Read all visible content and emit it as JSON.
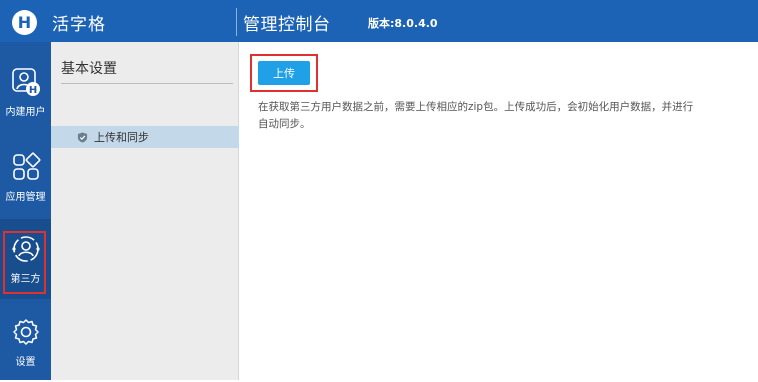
{
  "header": {
    "logo_letter": "H",
    "app_name": "活字格",
    "console_title": "管理控制台",
    "version": "版本:8.0.4.0"
  },
  "leftnav": {
    "items": [
      {
        "label": "内建用户",
        "icon": "builtin-user-icon"
      },
      {
        "label": "应用管理",
        "icon": "app-grid-icon"
      },
      {
        "label": "第三方",
        "icon": "third-party-user-icon",
        "active": true
      },
      {
        "label": "设置",
        "icon": "gear-icon"
      }
    ]
  },
  "subnav": {
    "title": "基本设置",
    "items": [
      {
        "label": "上传和同步",
        "icon": "shield-icon",
        "selected": true
      }
    ]
  },
  "main": {
    "upload_button": "上传",
    "description": "在获取第三方用户数据之前，需要上传相应的zip包。上传成功后，会初始化用户数据，并进行自动同步。"
  },
  "colors": {
    "topbar": "#1d63b5",
    "leftnav": "#1d5aa3",
    "button": "#1fa0e7",
    "highlight": "#e0302f",
    "selected_row": "#c3d9ea"
  }
}
